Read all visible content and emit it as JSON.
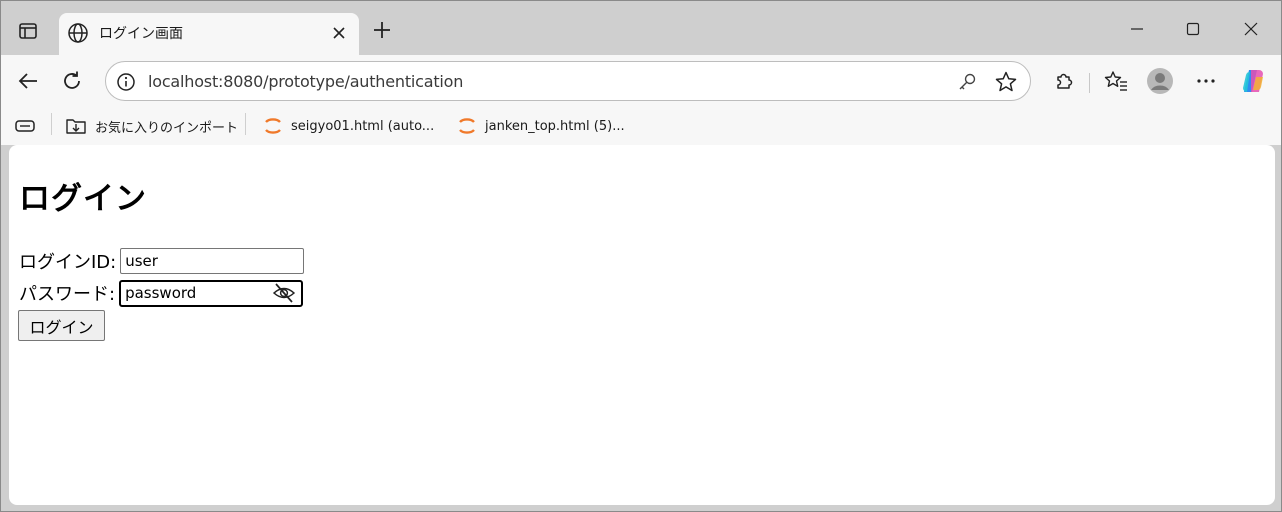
{
  "browser": {
    "tab": {
      "title": "ログイン画面"
    },
    "address": {
      "url": "localhost:8080/prototype/authentication"
    },
    "favorites": [
      {
        "label": "お気に入りのインポート",
        "icon": "import-favorites-icon"
      },
      {
        "label": "seigyo01.html (auto...",
        "icon": "site-favicon-orange"
      },
      {
        "label": "janken_top.html (5)...",
        "icon": "site-favicon-orange"
      }
    ]
  },
  "page": {
    "title": "ログイン",
    "login_id": {
      "label": "ログインID:",
      "value": "user"
    },
    "password": {
      "label": "パスワード:",
      "value": "password"
    },
    "submit_label": "ログイン"
  },
  "colors": {
    "chrome_bg": "#cfcfcf",
    "toolbar_bg": "#f7f7f7",
    "favicon_orange": "#f0792a"
  }
}
